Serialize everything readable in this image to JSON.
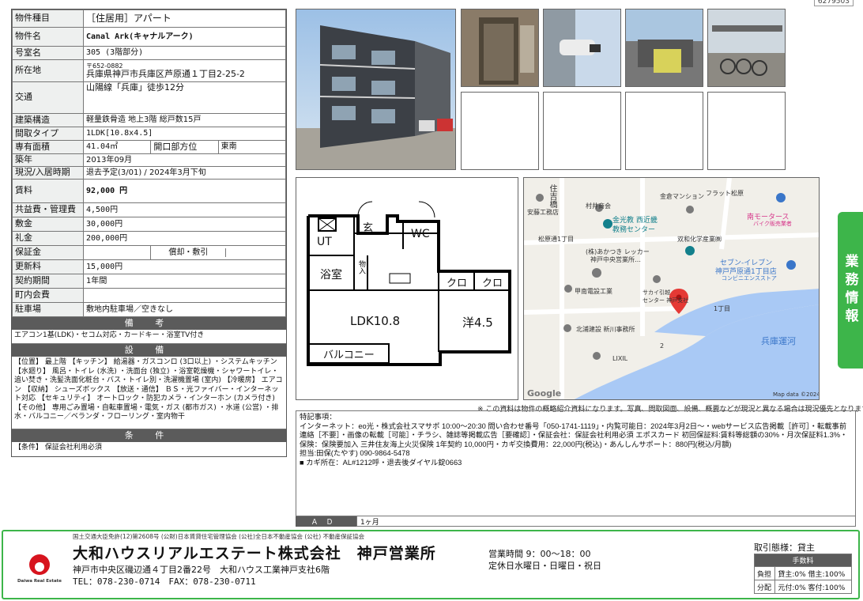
{
  "doc_id": "6279503",
  "spec": {
    "rows": [
      {
        "label": "物件種目",
        "value": "［住居用］アパート"
      },
      {
        "label": "物件名",
        "value": "Canal Ark(キャナルアーク)"
      },
      {
        "label": "号室名",
        "value": "305 (3階部分)"
      },
      {
        "label": "所在地",
        "zip": "〒652-0882",
        "value": "兵庫県神戸市兵庫区芦原通１丁目2-25-2"
      },
      {
        "label": "交通",
        "value": "山陽線「兵庫」徒歩12分"
      },
      {
        "label": "建築構造",
        "value": "軽量鉄骨造 地上3階 総戸数15戸"
      },
      {
        "label": "間取タイプ",
        "value": "1LDK[10.8x4.5]"
      },
      {
        "label": "専有面積",
        "value": "41.04㎡",
        "sub_label": "開口部方位",
        "sub_value": "東南"
      },
      {
        "label": "築年",
        "value": "2013年09月"
      },
      {
        "label": "現況/入居時期",
        "value": "退去予定(3/01) / 2024年3月下旬"
      },
      {
        "label": "賃料",
        "value": "92,000 円"
      },
      {
        "label": "共益費・管理費",
        "value": "4,500円"
      },
      {
        "label": "敷金",
        "value": "30,000円"
      },
      {
        "label": "礼金",
        "value": "200,000円"
      },
      {
        "label": "保証金",
        "value": "",
        "sub_label": "償却・敷引",
        "sub_value": ""
      },
      {
        "label": "更新料",
        "value": "15,000円"
      },
      {
        "label": "契約期間",
        "value": "1年間"
      },
      {
        "label": "町内会費",
        "value": ""
      },
      {
        "label": "駐車場",
        "value": "敷地内駐車場／空きなし"
      }
    ]
  },
  "sections": {
    "biko_title": "備 考",
    "biko_text": "エアコン1基(LDK)・セコム対応・カードキー・浴室TV付き",
    "setsubi_title": "設 備",
    "setsubi_text": "【位置】 最上階 【キッチン】 給湯器・ガスコンロ (3口以上) ・システムキッチン 【水廻り】 風呂・トイレ (水洗) ・洗面台 (独立) ・浴室乾燥機・シャワートイレ・追い焚き・洗髪洗面化粧台・バス・トイレ別・洗濯機置場 (室内) 【冷暖房】 エアコン 【収納】 シューズボックス 【放送・通信】 ＢＳ・光ファイバー・インターネット対応 【セキュリティ】 オートロック・防犯カメラ・インターホン (カメラ付き) 【その他】 専用ごみ置場・自転車置場・電気・ガス (都市ガス) ・水道 (公営) ・排水・バルコニー／ベランダ・フローリング・室内物干",
    "joken_title": "条 件",
    "joken_text": "【条件】 保証会社利用必須"
  },
  "floor_plan": {
    "rooms": [
      "玄",
      "UT",
      "WC",
      "浴室",
      "物入",
      "クロ",
      "クロ",
      "LDK10.8",
      "洋4.5",
      "バルコニー"
    ]
  },
  "map": {
    "labels": {
      "jinja": "安藤工務店",
      "murai": "村井商会",
      "kinkura": "金倉マンション",
      "flat": "フラット松原",
      "minami_motors": "南モータース",
      "minami_sub": "バイク販売業者",
      "konko1": "金光教 西近畿",
      "konko2": "教務センター",
      "sowa": "双和化学産業㈱",
      "matsubara_st": "松原通1丁目",
      "akatsuki1": "(株)あかつき レッカー",
      "akatsuki2": "神戸中央営業所…",
      "seven1": "セブン‐イレブン",
      "seven2": "神戸芦原通1丁目店",
      "seven3": "コンビニエンスストア",
      "konan": "甲南電設工業",
      "sakai1": "サカイ引越",
      "sakai2": "センター 神戸支社",
      "chome": "1丁目",
      "hokutsu": "北浦建設 新川事務所",
      "canal": "兵庫運河",
      "lixil": "LIXIL",
      "num2": "2",
      "road": "住吉橋",
      "google": "Google",
      "mapdata": "Map data ©2024"
    }
  },
  "sidetab": "業務情報",
  "disclaimer": "※ この資料は物件の概略紹介資料になります。写真、間取図面、設備、概要などが現況と異なる場合は現況優先となります。",
  "notes": {
    "title": "特記事項：",
    "body": "インターネット：eo光・株式会社スマサポ 10:00～20:30 問い合わせ番号「050-1741-1119」・内覧可能日：2024年3月2日～・webサービス広告掲載［許可］・転載事前連絡［不要］・画像の転載［可能］・チラシ、雑誌等掲載広告［要確認］・保証会社：保証会社利用必須 エポスカード 初回保証料:賃料等総額の30%・月次保証料1.3%・保険：保険要加入 三井住友海上火災保険 1年契約 10,000円・カギ交換費用：22,000円(税込)・あんしんサポート：880円(税込/月額)",
    "staff": "担当:田保(たやす) 090-9864-5478",
    "key": "■ カギ所在：AL#1212呼・退去後ダイヤル錠0663"
  },
  "ad": {
    "label": "ＡＤ",
    "value": "1ヶ月"
  },
  "footer": {
    "license": "国土交通大臣免許(12)第2608号 (公財)日本賃貸住宅管理協会 (公社)全日本不動産協会 (公社) 不動産保証協会",
    "company": "大和ハウスリアルエステート株式会社　神戸営業所",
    "address": "神戸市中央区磯辺通４丁目2番22号　大和ハウス工業神戸支社6階",
    "tel": "TEL：078-230-0714　FAX：078-230-0711",
    "logo_text": "Daiwa Real Estate",
    "hours": "営業時間 9：00～18：00",
    "holiday": "定休日水曜日・日曜日・祝日",
    "torihiki_label": "取引態様：貸主",
    "fee_title": "手数料",
    "fee_rows": [
      {
        "k": "負担",
        "v": "貸主:0% 借主:100%"
      },
      {
        "k": "分配",
        "v": "元付:0% 客付:100%"
      }
    ]
  }
}
